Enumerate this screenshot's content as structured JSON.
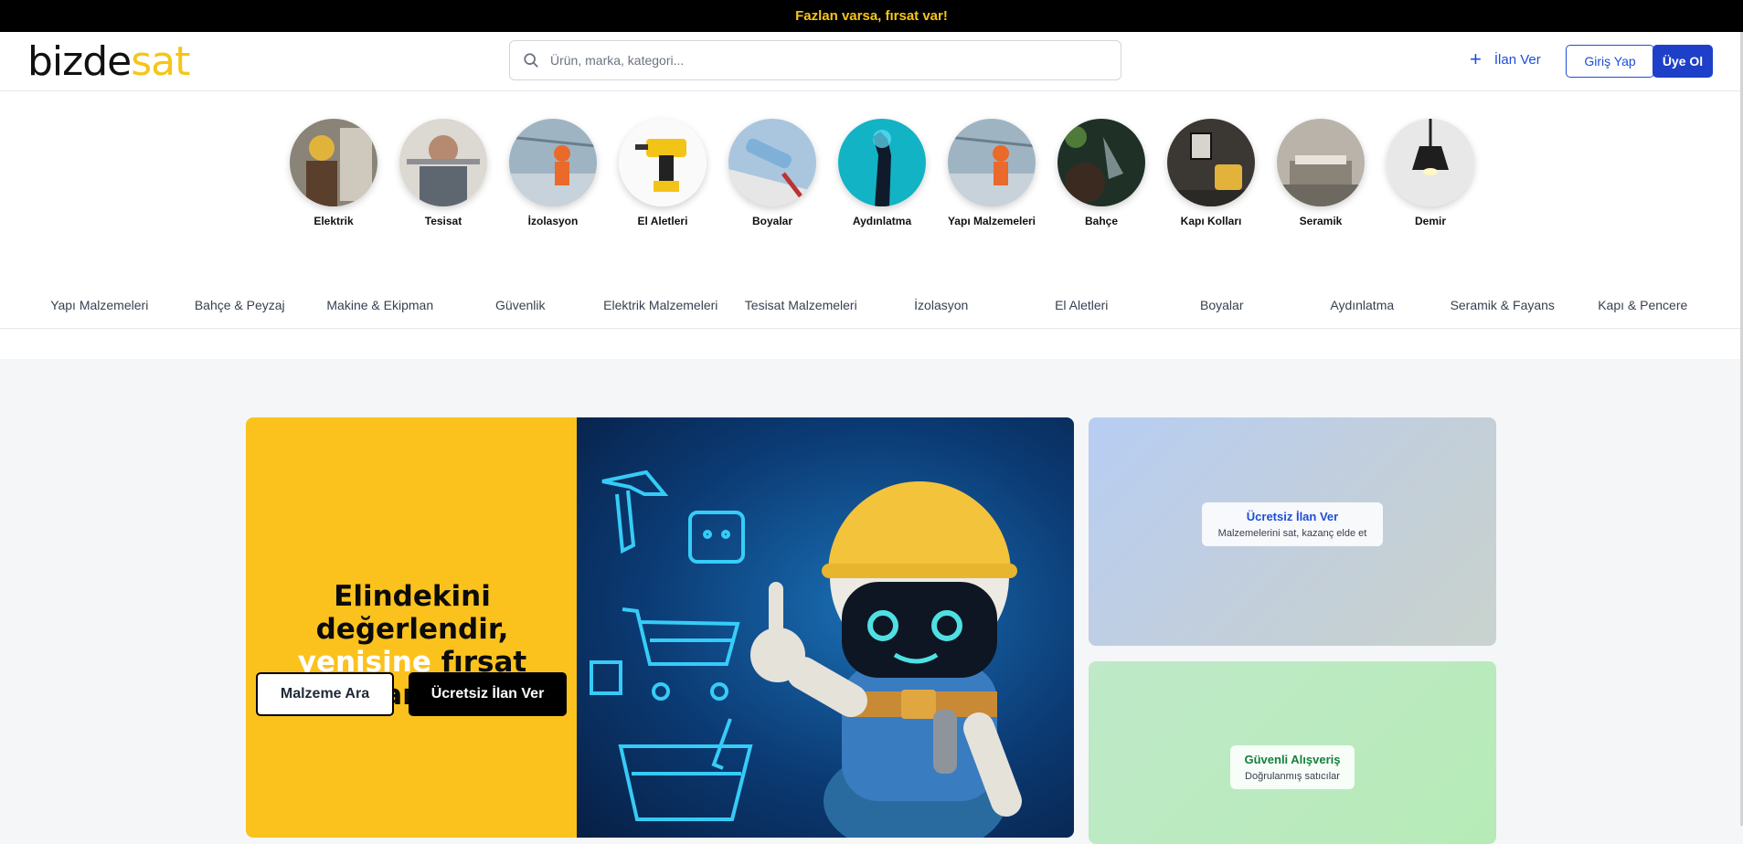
{
  "announcement": "Fazlan varsa, fırsat var!",
  "header": {
    "logo_part1": "bizde",
    "logo_part2": "sat",
    "search_placeholder": "Ürün, marka, kategori...",
    "ilan_ver": "İlan Ver",
    "login": "Giriş Yap",
    "register": "Üye Ol"
  },
  "categories": [
    {
      "label": "Elektrik"
    },
    {
      "label": "Tesisat"
    },
    {
      "label": "İzolasyon"
    },
    {
      "label": "El Aletleri"
    },
    {
      "label": "Boyalar"
    },
    {
      "label": "Aydınlatma"
    },
    {
      "label": "Yapı Malzemeleri"
    },
    {
      "label": "Bahçe"
    },
    {
      "label": "Kapı Kolları"
    },
    {
      "label": "Seramik"
    },
    {
      "label": "Demir"
    }
  ],
  "nav": [
    "Yapı Malzemeleri",
    "Bahçe & Peyzaj",
    "Makine & Ekipman",
    "Güvenlik",
    "Elektrik Malzemeleri",
    "Tesisat Malzemeleri",
    "İzolasyon",
    "El Aletleri",
    "Boyalar",
    "Aydınlatma",
    "Seramik & Fayans",
    "Kapı & Pencere"
  ],
  "hero": {
    "title_line1": "Elindekini değerlendir,",
    "title_highlight": "yenisine",
    "title_rest": "fırsat yarat.",
    "button_search": "Malzeme Ara",
    "button_post": "Ücretsiz İlan Ver"
  },
  "side_cards": {
    "card1": {
      "title": "Ücretsiz İlan Ver",
      "subtitle": "Malzemelerini sat, kazanç elde et"
    },
    "card2": {
      "title": "Güvenli Alışveriş",
      "subtitle": "Doğrulanmış satıcılar"
    }
  },
  "colors": {
    "accent": "#f5c518",
    "primary": "#1e40c8",
    "hero_yellow": "#fbc21e"
  }
}
